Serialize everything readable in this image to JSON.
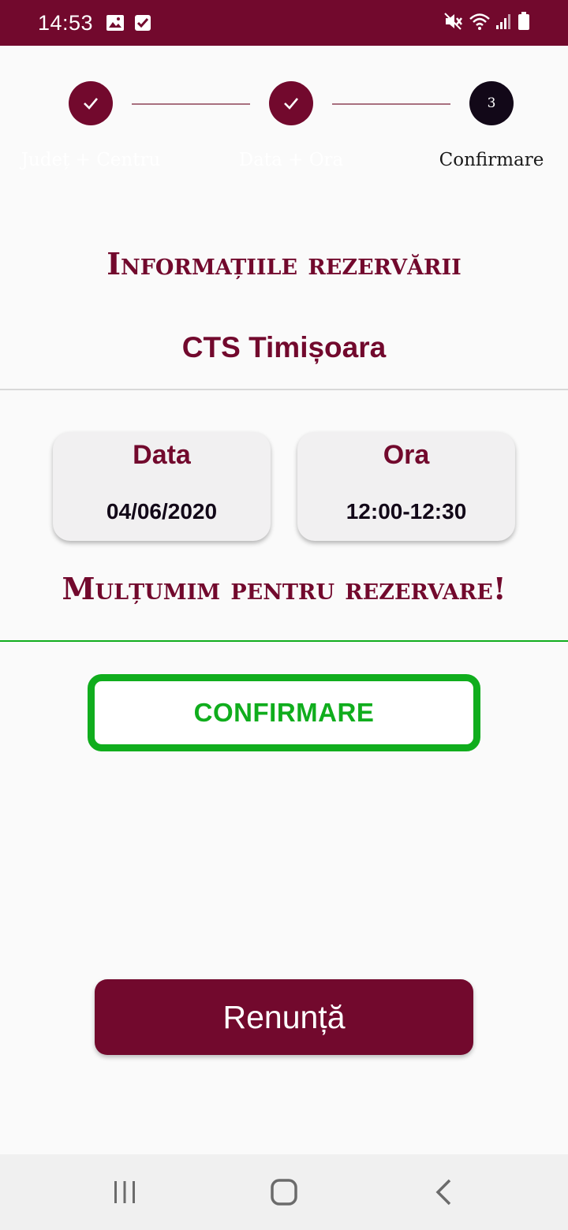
{
  "status_bar": {
    "time": "14:53",
    "left_icons": [
      "image-icon",
      "checkbox-icon"
    ],
    "right_icons": [
      "mute-icon",
      "wifi-icon",
      "signal-icon",
      "battery-icon"
    ]
  },
  "stepper": {
    "steps": [
      {
        "label": "Județ + Centru",
        "state": "done",
        "icon": "check-icon"
      },
      {
        "label": "Data + Ora",
        "state": "done",
        "icon": "check-icon"
      },
      {
        "label": "Confirmare",
        "state": "active",
        "number": "3"
      }
    ]
  },
  "reservation": {
    "title": "Informațiile rezervării",
    "center_name": "CTS Timișoara",
    "date_label": "Data",
    "date_value": "04/06/2020",
    "time_label": "Ora",
    "time_value": "12:00-12:30",
    "thanks": "Mulțumim pentru rezervare!"
  },
  "actions": {
    "confirm_label": "CONFIRMARE",
    "cancel_label": "Renunță"
  },
  "navigation": {
    "buttons": [
      "recent-apps-icon",
      "home-icon",
      "back-icon"
    ]
  },
  "colors": {
    "brand": "#72092d",
    "confirm_green": "#10ad1d",
    "active_step": "#120818"
  }
}
